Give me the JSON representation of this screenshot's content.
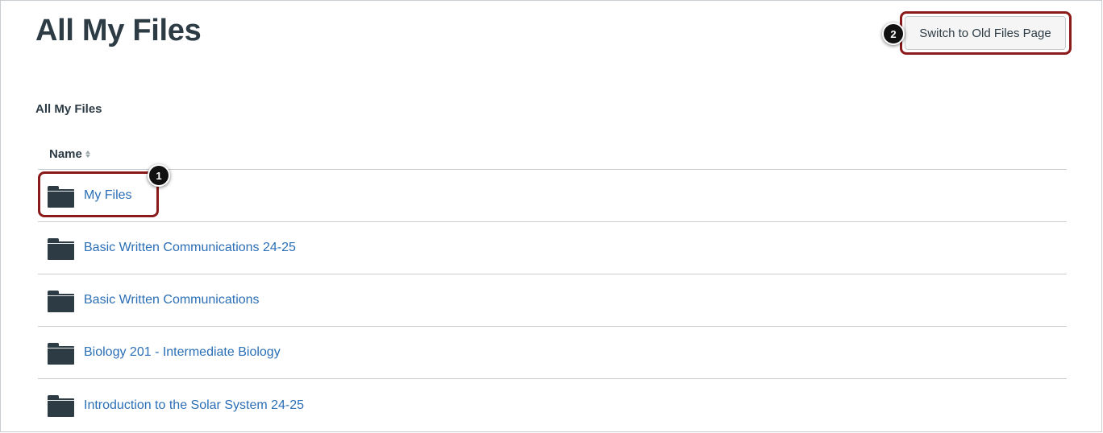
{
  "page": {
    "title": "All My Files",
    "switch_button_label": "Switch to Old Files Page"
  },
  "breadcrumb": {
    "label": "All My Files"
  },
  "table": {
    "columns": [
      {
        "label": "Name",
        "sortable": true
      }
    ],
    "rows": [
      {
        "name": "My Files",
        "icon": "folder-icon"
      },
      {
        "name": "Basic Written Communications 24-25",
        "icon": "folder-icon"
      },
      {
        "name": "Basic Written Communications",
        "icon": "folder-icon"
      },
      {
        "name": "Biology 201 - Intermediate Biology",
        "icon": "folder-icon"
      },
      {
        "name": "Introduction to the Solar System 24-25",
        "icon": "folder-icon"
      }
    ]
  },
  "callouts": [
    {
      "number": "1"
    },
    {
      "number": "2"
    }
  ],
  "colors": {
    "link": "#2b6fb6",
    "text": "#2d3b45",
    "callout_border": "#8b1a1a",
    "callout_badge": "#111111",
    "divider": "#c7cdd1"
  }
}
